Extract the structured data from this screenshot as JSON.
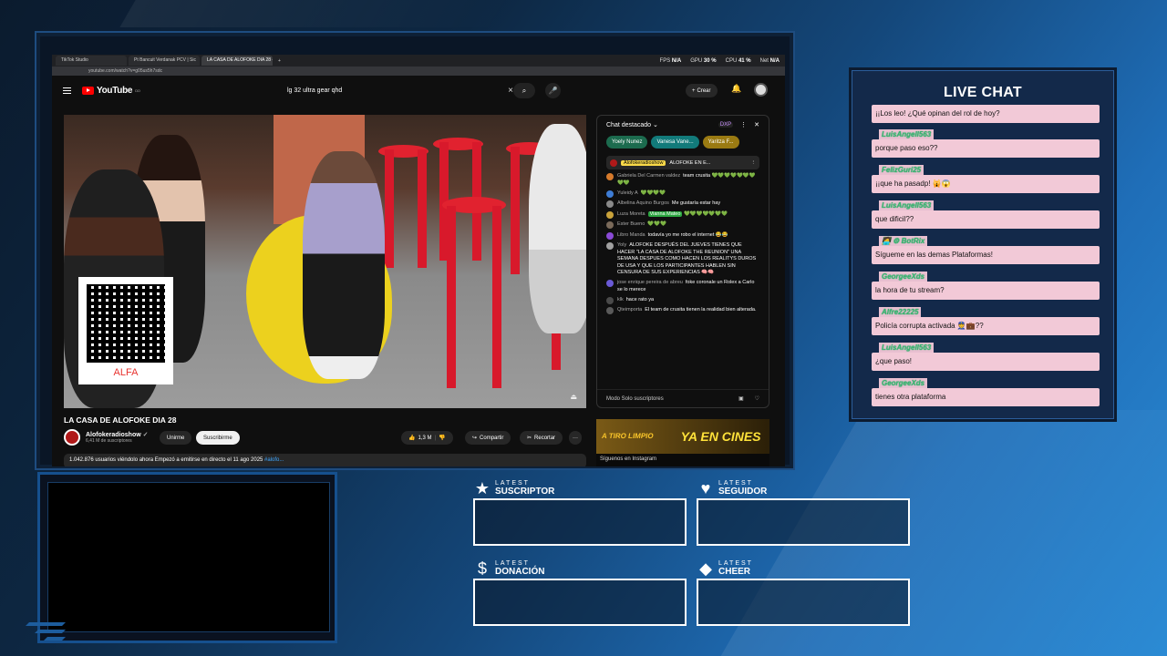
{
  "browser": {
    "tabs": [
      "TikTok Studio",
      "Pt Bancuit Verdanak PCV | Sic",
      "LA CASA DE ALOFOKE DIA 28 - Yo"
    ],
    "stats": {
      "fps_label": "FPS",
      "fps_value": "N/A",
      "gpu_label": "GPU",
      "gpu_value": "30 %",
      "cpu_label": "CPU",
      "cpu_value": "41 %",
      "net_label": "Net",
      "net_value": "N/A"
    },
    "url": "youtube.com/watch?v=g05us5h7sdc"
  },
  "youtube": {
    "logo": "YouTube",
    "country": "DO",
    "search_query": "lg 32 ultra gear qhd",
    "clear_icon": "×",
    "search_icon": "⌕",
    "mic_icon": "🎤",
    "create_label": "Crear",
    "video_title": "LA CASA DE ALOFOKE DIA 28",
    "qr_label": "ALFA",
    "channel_name": "Alofokeradioshow",
    "channel_subs": "6,41 M de suscriptores",
    "join_label": "Unirme",
    "subscribe_label": "Suscribirme",
    "likes": "1,3 M",
    "share_label": "Compartir",
    "clip_label": "Recortar",
    "more_label": "···",
    "description": "1.042.876 usuarios viéndolo ahora  Empezó a emitirse en directo el 11 ago 2025",
    "description_tag": "#alofo..."
  },
  "ytchat": {
    "header": "Chat destacado",
    "dxp": "DXP",
    "chips": [
      "Yoely Nunez",
      "Vanesa Vane...",
      "Yaritza F..."
    ],
    "pinned_user": "Alofokeradioshow",
    "pinned_text": "ALOFOKE EN E...",
    "messages": [
      {
        "user": "Gabriela Del Carmen valdez",
        "text": "team crusita 💚💚💚💚💚💚💚💚💚",
        "color": "#d67a2b"
      },
      {
        "user": "Yuleidy A",
        "text": "💚💚💚💚",
        "color": "#3e7dd6"
      },
      {
        "user": "Albelina Aquino Burgos",
        "text": "Me gustaría estar hay",
        "color": "#8a8a8a"
      },
      {
        "user": "Luza Moreta",
        "highlight": "Vianna Mateo",
        "text": "💚💚💚💚💚💚💚",
        "color": "#c9a23a"
      },
      {
        "user": "Ester Bueno",
        "text": "💚💚💚",
        "color": "#7a6a5a"
      },
      {
        "user": "Libro Manda",
        "text": "todavía yo me robo el internet 😂😂",
        "color": "#8a4ad6"
      },
      {
        "user": "Yoly",
        "text": "ALOFOKE DESPUÉS DEL JUEVES TIENES QUE HACER \"LA CASA DE ALOFOKE THE REUNION\" UNA SEMANA DESPUES COMO HACEN LOS REALITYS DUROS DE USA Y QUE LOS PARTICIPANTES HABLEN SIN CENSURA DE SUS EXPERIENCIAS 🧠🧠",
        "color": "#a0a0a0"
      },
      {
        "user": "jose enrique pereira de abreu",
        "text": "foke coronale un Rolex a Carlo se lo merece",
        "color": "#6a5ad6"
      },
      {
        "user": "klk",
        "text": "hace rato ya",
        "color": "#4a4a4a"
      },
      {
        "user": "Qteimporta",
        "text": "El team de crusita tienen la realidad bien alterada.",
        "color": "#5a5a5a"
      }
    ],
    "footer": "Modo Solo suscriptores",
    "ad_left": "A TIRO LIMPIO",
    "ad_right": "YA EN CINES",
    "ad_bottom": "Síguenos en Instagram"
  },
  "livechat": {
    "title": "LIVE CHAT",
    "items": [
      {
        "name": "",
        "msg": "¡¡Los leo! ¿Qué opinan del rol de hoy?"
      },
      {
        "name": "LuisAngell563",
        "msg": "porque paso eso??"
      },
      {
        "name": "FelizGuri25",
        "msg": "¡¡que ha pasadp! 🙀😱"
      },
      {
        "name": "LuisAngell563",
        "msg": "que dificil??"
      },
      {
        "name": "🧑‍💻 ⚙ BotRix",
        "msg": "Sígueme en las demas Plataformas!"
      },
      {
        "name": "GeorgeeXds",
        "msg": "la hora de tu stream?"
      },
      {
        "name": "Alfre22225",
        "msg": "Policía corrupta activada 👮💼??"
      },
      {
        "name": "LuisAngell563",
        "msg": "¿que paso!"
      },
      {
        "name": "GeorgeeXds",
        "msg": "tienes otra plataforma"
      }
    ]
  },
  "latest": [
    {
      "icon": "star-icon",
      "glyph": "★",
      "kicker": "LATEST",
      "label": "SUSCRIPTOR"
    },
    {
      "icon": "heart-icon",
      "glyph": "♥",
      "kicker": "LATEST",
      "label": "SEGUIDOR"
    },
    {
      "icon": "dollar-icon",
      "glyph": "$",
      "kicker": "LATEST",
      "label": "DONACIÓN"
    },
    {
      "icon": "diamond-icon",
      "glyph": "◆",
      "kicker": "LATEST",
      "label": "CHEER"
    }
  ],
  "colors": {
    "accent": "#1e6fbf",
    "chat_pink": "#f2c9d7",
    "chat_name": "#3cb371",
    "yt_red": "#ff0000"
  }
}
